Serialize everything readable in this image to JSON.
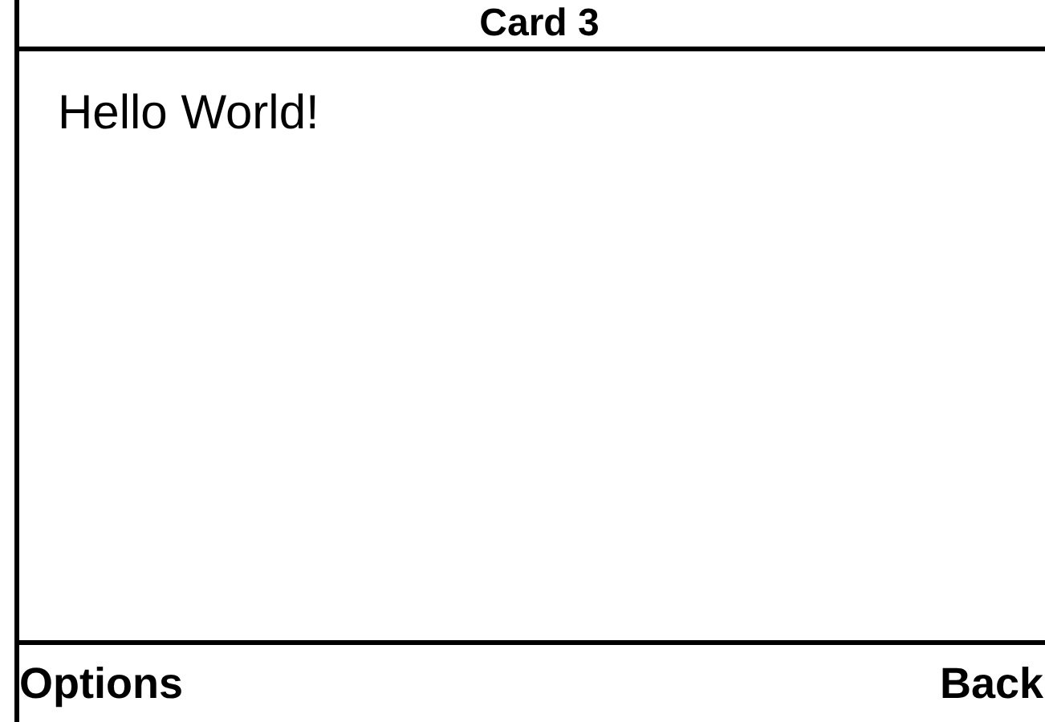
{
  "title": "Card 3",
  "content": "Hello World!",
  "softkeys": {
    "left": "Options",
    "right": "Back"
  }
}
